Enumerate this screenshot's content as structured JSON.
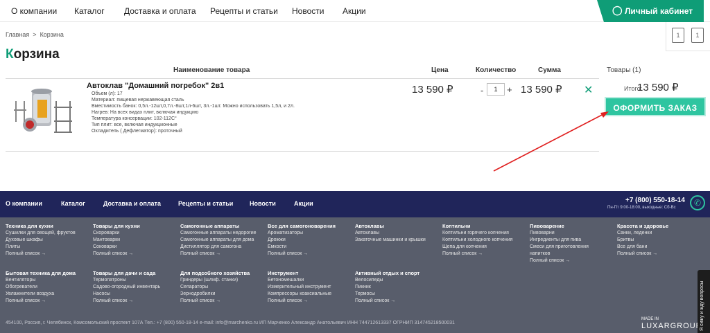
{
  "topnav": {
    "items": [
      "О компании",
      "Каталог",
      "Доставка и оплата",
      "Рецепты и статьи",
      "Новости",
      "Акции"
    ],
    "cabinet": "Личный кабинет",
    "favorites_count": "1",
    "cart_count": "1"
  },
  "breadcrumbs": {
    "home": "Главная",
    "sep": ">",
    "current": "Корзина"
  },
  "page_title_first": "К",
  "page_title_rest": "орзина",
  "table": {
    "headers": {
      "name": "Наименование товара",
      "price": "Цена",
      "qty": "Количество",
      "sum": "Сумма"
    },
    "item": {
      "name": "Автоклав \"Домашний погребок\" 2в1",
      "specs": [
        "Объем (л): 17",
        "Материал: пищевая нержавеющая сталь",
        "Вместимость банок: 0,5л.-12шт,0,7л.-8шт,1л-6шт, 3л.-1шт. Можно использовать 1,5л, и 2л.",
        "Нагрев: На всех видах плит, включая индукцию",
        "Температура консервации: 102-112С°",
        "Тип плит: все, включая индукционные",
        "Охладитель ( Дефлегматор): проточный"
      ],
      "price": "13 590 ₽",
      "qty_minus": "-",
      "qty": "1",
      "qty_plus": "+",
      "sum": "13 590 ₽",
      "remove": "✕"
    }
  },
  "summary": {
    "items": "Товары (1)",
    "total_label": "Итого:",
    "total": "13 590 ₽",
    "checkout": "ОФОРМИТЬ ЗАКАЗ"
  },
  "footer": {
    "nav": [
      "О компании",
      "Каталог",
      "Доставка и оплата",
      "Рецепты и статьи",
      "Новости",
      "Акции"
    ],
    "phone": "+7 (800) 550-18-14",
    "hours": "Пн-Пт 9:00-18:00, выходные: Сб-Вс",
    "columns": [
      {
        "title": "Техника для кухни",
        "items": [
          "Сушилки для овощей, фруктов",
          "Духовые шкафы",
          "Плиты",
          "Полный список →"
        ]
      },
      {
        "title": "Товары для кухни",
        "items": [
          "Скороварки",
          "Мантоварки",
          "Соковарки",
          "Полный список →"
        ]
      },
      {
        "title": "Самогонные аппараты",
        "items": [
          "Самогонные аппараты недорогие",
          "Самогонные аппараты для дома",
          "Дистиллятор для самогона",
          "Полный список →"
        ]
      },
      {
        "title": "Все для самогоноварения",
        "items": [
          "Ароматизаторы",
          "Дрожжи",
          "Емкости",
          "Полный список →"
        ]
      },
      {
        "title": "Автоклавы",
        "items": [
          "Автоклавы",
          "Закаточные машинки и крышки"
        ]
      },
      {
        "title": "Коптильни",
        "items": [
          "Коптильни горячего копчения",
          "Коптильни холодного копчения",
          "Щепа для копчения",
          "Полный список →"
        ]
      },
      {
        "title": "Пивоварение",
        "items": [
          "Пивоварни",
          "Ингредиенты для пива",
          "Смеси для приготовления",
          "напитков",
          "Полный список →"
        ]
      },
      {
        "title": "Красота и здоровье",
        "items": [
          "Санки, леденки",
          "Бритвы",
          "Все для бани",
          "Полный список →"
        ]
      },
      {
        "title": "Бытовая техника для дома",
        "items": [
          "Вентиляторы",
          "Обогреватели",
          "Увлажнители воздуха",
          "Полный список →"
        ]
      },
      {
        "title": "Товары для дачи и сада",
        "items": [
          "Термопатроны",
          "Садово-огородный инвентарь",
          "Насосы",
          "Полный список →"
        ]
      },
      {
        "title": "Для подсобного хозяйства",
        "items": [
          "Гриндеры (шлиф. станки)",
          "Сепараторы",
          "Зернодробилки",
          "Полный список →"
        ]
      },
      {
        "title": "Инструмент",
        "items": [
          "Бетономешалки",
          "Измерительный инструмент",
          "Компрессоры коаксиальные",
          "Полный список →"
        ]
      },
      {
        "title": "Активный отдых и спорт",
        "items": [
          "Велосипеды",
          "Пикник",
          "Термосы",
          "Полный список →"
        ]
      }
    ],
    "address": "454100, Россия, г. Челябинск, Комсомольский проспект 107А    Тел.: +7 (800) 550-18-14    e-mail: info@marchenko.ru    ИП Марченко Александр Анатольевич    ИНН 744712613337    ОГРНИП 314745218500031",
    "made_in": "MADE IN",
    "brand": "LUXARGROUP",
    "vertical_tab": "Я сижу и жду вопросы"
  },
  "colors": {
    "accent": "#0f9d77",
    "button": "#2ec5a0",
    "footer_top": "#20255a",
    "footer_bottom": "#585d6b",
    "arrow": "#e02020"
  }
}
